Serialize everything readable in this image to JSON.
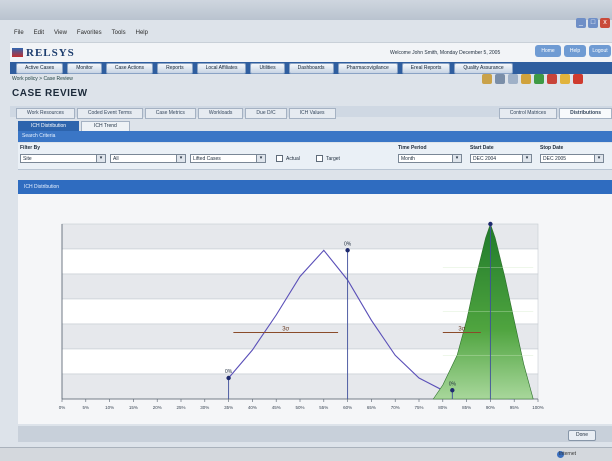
{
  "window": {
    "controls": [
      "_",
      "□",
      "x"
    ]
  },
  "menu": [
    "File",
    "Edit",
    "View",
    "Favorites",
    "Tools",
    "Help"
  ],
  "brand": {
    "name": "RELSYS",
    "welcome": "Welcome John Smith, Monday December 5, 2005"
  },
  "help_buttons": [
    "Home",
    "Help",
    "Logout"
  ],
  "nav": [
    "Active Cases",
    "Monitor",
    "Case Actions",
    "Reports",
    "Local Affiliates",
    "Utilities",
    "Dashboards",
    "Pharmacovigilance",
    "Ereal Reports",
    "Quality Assurance"
  ],
  "breadcrumb": "Work policy > Case Review",
  "page_title": "CASE REVIEW",
  "tabs": [
    "Work Resources",
    "Coded Event Terms",
    "Case Metrics",
    "Workloads",
    "Due D/C",
    "ICH Values"
  ],
  "tabs_right": [
    "Control Matrices",
    "Distributions"
  ],
  "subtabs": [
    "ICH Distribution",
    "ICH Trend"
  ],
  "section_title": "Search Criteria",
  "filters": {
    "filter_by_label": "Filter By",
    "filter_values": [
      "Site",
      "All",
      "Lifted Cases"
    ],
    "actual_label": "Actual",
    "target_label": "Target",
    "time_period_label": "Time Period",
    "time_period_value": "Month",
    "start_date_label": "Start Date",
    "start_date_value": "DEC 2004",
    "stop_date_label": "Stop Date",
    "stop_date_value": "DEC 2005"
  },
  "chart_section_title": "ICH Distribution",
  "chart_data": {
    "type": "area",
    "x_ticks": [
      "0%",
      "5%",
      "10%",
      "15%",
      "20%",
      "25%",
      "30%",
      "35%",
      "40%",
      "45%",
      "50%",
      "55%",
      "60%",
      "65%",
      "70%",
      "75%",
      "80%",
      "85%",
      "90%",
      "95%",
      "100%"
    ],
    "x_range": [
      0,
      100
    ],
    "y_range": [
      0,
      100
    ],
    "grid": true,
    "series": [
      {
        "x": [
          35,
          40,
          45,
          50,
          55,
          60,
          65,
          70,
          75,
          80,
          85,
          90,
          95
        ],
        "y": [
          12,
          28,
          48,
          70,
          85,
          68,
          45,
          25,
          12,
          5,
          2,
          1,
          0
        ]
      },
      {
        "x": [
          78,
          80,
          83,
          85,
          87,
          89,
          90,
          91,
          93,
          95,
          97,
          99
        ],
        "y": [
          0,
          8,
          25,
          45,
          70,
          92,
          100,
          92,
          70,
          45,
          20,
          0
        ]
      }
    ],
    "markers": [
      {
        "x": 60,
        "y": 85,
        "label": "0%"
      },
      {
        "x": 35,
        "y": 12,
        "label": "0%"
      },
      {
        "x": 82,
        "y": 5,
        "label": "0%"
      },
      {
        "x": 90,
        "y": 100,
        "label": ""
      }
    ],
    "bands": [
      {
        "x_from": 36,
        "x_to": 58,
        "y": 38,
        "label": "3σ"
      },
      {
        "x_from": 80,
        "x_to": 88,
        "y": 38,
        "label": "3σ"
      }
    ]
  },
  "footer_button": "Done",
  "status": "Internet"
}
